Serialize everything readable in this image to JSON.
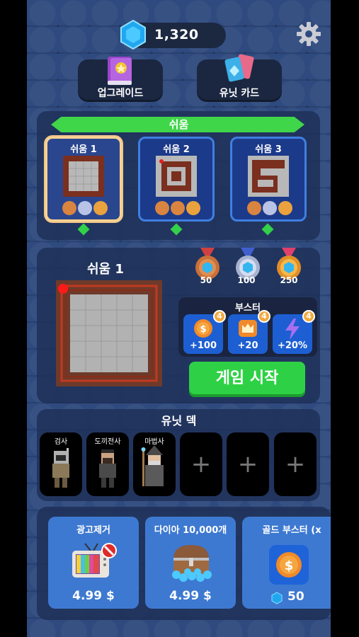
{
  "header": {
    "gems": "1,320"
  },
  "menu": {
    "upgrade_label": "업그레이드",
    "cards_label": "유닛 카드"
  },
  "difficulty": {
    "label": "쉬움"
  },
  "stages": [
    {
      "label": "쉬움 1",
      "selected": true
    },
    {
      "label": "쉬움 2",
      "selected": false
    },
    {
      "label": "쉬움 3",
      "selected": false
    }
  ],
  "stage_detail": {
    "title": "쉬움 1",
    "medal_rewards": [
      "50",
      "100",
      "250"
    ]
  },
  "booster": {
    "title": "부스터",
    "items": [
      {
        "value": "+100",
        "count": "4",
        "icon": "coin-icon"
      },
      {
        "value": "+20",
        "count": "4",
        "icon": "crown-icon"
      },
      {
        "value": "+20%",
        "count": "4",
        "icon": "lightning-icon"
      }
    ]
  },
  "start_button": "게임 시작",
  "deck": {
    "title": "유닛 덱",
    "units": [
      "검사",
      "도끼전사",
      "마법사"
    ],
    "empty_slots": [
      "+",
      "+",
      "+"
    ]
  },
  "shop": [
    {
      "title": "광고제거",
      "price": "4.99 $"
    },
    {
      "title": "다이아 10,000개",
      "price": "4.99 $"
    },
    {
      "title": "골드 부스터 (x",
      "price": "50"
    }
  ],
  "colors": {
    "accent_green": "#2ed145",
    "panel_blue": "#3d79d1",
    "background": "#2f4a7e"
  }
}
